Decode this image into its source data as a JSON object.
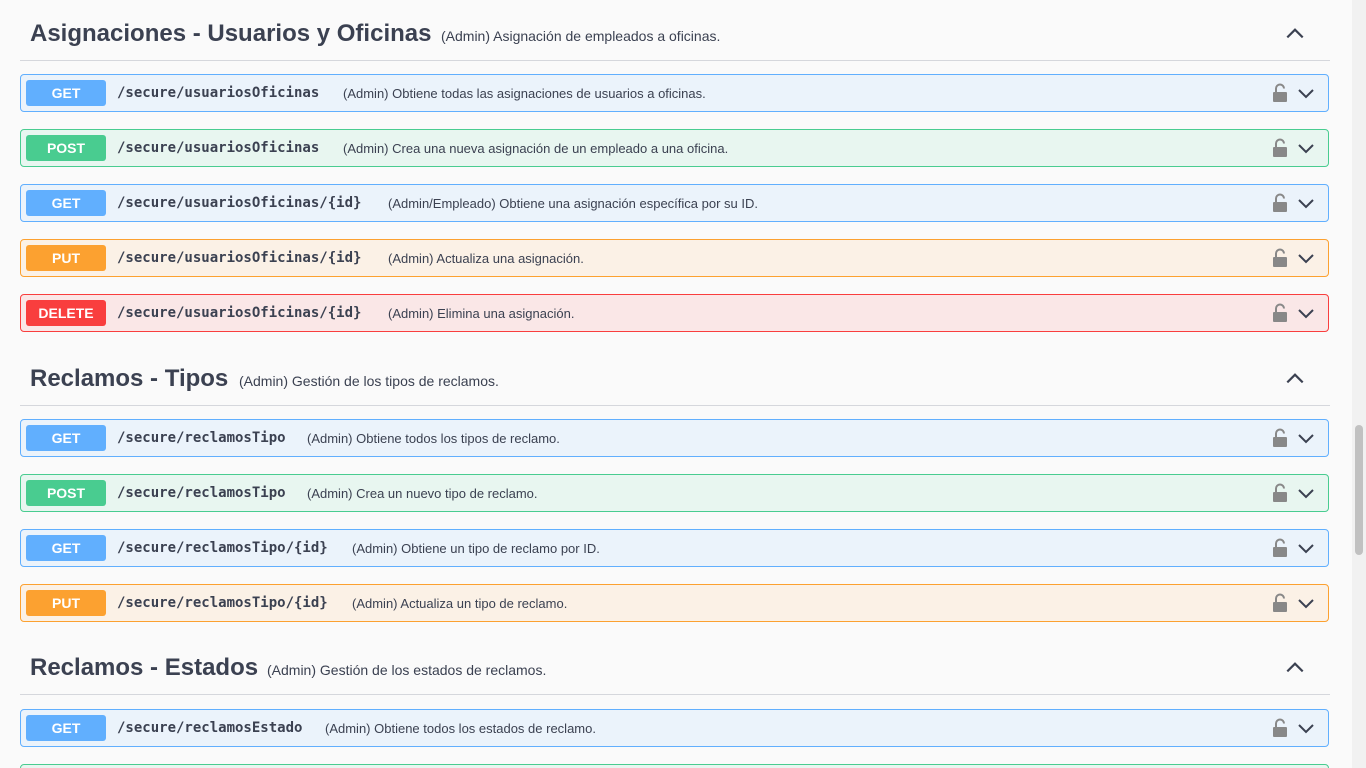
{
  "colors": {
    "get": "#61affe",
    "post": "#49cc90",
    "put": "#fca130",
    "delete": "#f93e3e"
  },
  "sections": [
    {
      "title": "Asignaciones - Usuarios y Oficinas",
      "description": "(Admin) Asignación de empleados a oficinas.",
      "toggle_icon": "chevron-up-icon",
      "operations": [
        {
          "method": "GET",
          "path": "/secure/usuariosOficinas",
          "summary": "(Admin) Obtiene todas las asignaciones de usuarios a oficinas."
        },
        {
          "method": "POST",
          "path": "/secure/usuariosOficinas",
          "summary": "(Admin) Crea una nueva asignación de un empleado a una oficina."
        },
        {
          "method": "GET",
          "path": "/secure/usuariosOficinas/{id}",
          "summary": "(Admin/Empleado) Obtiene una asignación específica por su ID."
        },
        {
          "method": "PUT",
          "path": "/secure/usuariosOficinas/{id}",
          "summary": "(Admin) Actualiza una asignación."
        },
        {
          "method": "DELETE",
          "path": "/secure/usuariosOficinas/{id}",
          "summary": "(Admin) Elimina una asignación."
        }
      ]
    },
    {
      "title": "Reclamos - Tipos",
      "description": "(Admin) Gestión de los tipos de reclamos.",
      "toggle_icon": "chevron-up-icon",
      "operations": [
        {
          "method": "GET",
          "path": "/secure/reclamosTipo",
          "summary": "(Admin) Obtiene todos los tipos de reclamo."
        },
        {
          "method": "POST",
          "path": "/secure/reclamosTipo",
          "summary": "(Admin) Crea un nuevo tipo de reclamo."
        },
        {
          "method": "GET",
          "path": "/secure/reclamosTipo/{id}",
          "summary": "(Admin) Obtiene un tipo de reclamo por ID."
        },
        {
          "method": "PUT",
          "path": "/secure/reclamosTipo/{id}",
          "summary": "(Admin) Actualiza un tipo de reclamo."
        }
      ]
    },
    {
      "title": "Reclamos - Estados",
      "description": "(Admin) Gestión de los estados de reclamos.",
      "toggle_icon": "chevron-up-icon",
      "operations": [
        {
          "method": "GET",
          "path": "/secure/reclamosEstado",
          "summary": "(Admin) Obtiene todos los estados de reclamo."
        }
      ]
    }
  ]
}
